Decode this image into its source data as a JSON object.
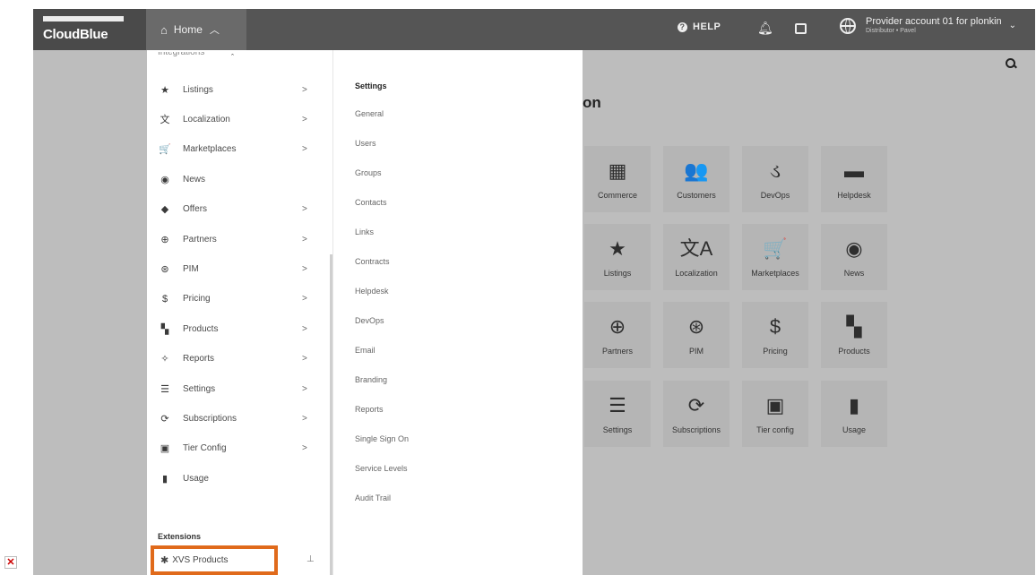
{
  "header": {
    "logo": "CloudBlue",
    "home_label": "Home",
    "help_label": "HELP",
    "account_name": "Provider account 01 for plonkin",
    "account_role": "Distributor • Pavel"
  },
  "page": {
    "heading": "on",
    "tiles": [
      {
        "label": "Commerce",
        "icon": "▦"
      },
      {
        "label": "Customers",
        "icon": "👥"
      },
      {
        "label": "DevOps",
        "icon": "ડ"
      },
      {
        "label": "Helpdesk",
        "icon": "▬"
      },
      {
        "label": "Listings",
        "icon": "★"
      },
      {
        "label": "Localization",
        "icon": "文A"
      },
      {
        "label": "Marketplaces",
        "icon": "🛒"
      },
      {
        "label": "News",
        "icon": "◉"
      },
      {
        "label": "Partners",
        "icon": "⊕"
      },
      {
        "label": "PIM",
        "icon": "⊛"
      },
      {
        "label": "Pricing",
        "icon": "$"
      },
      {
        "label": "Products",
        "icon": "▚"
      },
      {
        "label": "Settings",
        "icon": "☰"
      },
      {
        "label": "Subscriptions",
        "icon": "⟳"
      },
      {
        "label": "Tier config",
        "icon": "▣"
      },
      {
        "label": "Usage",
        "icon": "▮"
      }
    ]
  },
  "menu": {
    "cut_item": "Integrations",
    "items": [
      {
        "label": "Listings",
        "icon": "★",
        "arrow": ">"
      },
      {
        "label": "Localization",
        "icon": "文",
        "arrow": ">"
      },
      {
        "label": "Marketplaces",
        "icon": "🛒",
        "arrow": ">"
      },
      {
        "label": "News",
        "icon": "◉",
        "arrow": ""
      },
      {
        "label": "Offers",
        "icon": "◆",
        "arrow": ">"
      },
      {
        "label": "Partners",
        "icon": "⊕",
        "arrow": ">"
      },
      {
        "label": "PIM",
        "icon": "⊛",
        "arrow": ">"
      },
      {
        "label": "Pricing",
        "icon": "$",
        "arrow": ">"
      },
      {
        "label": "Products",
        "icon": "▚",
        "arrow": ">"
      },
      {
        "label": "Reports",
        "icon": "✧",
        "arrow": ">"
      },
      {
        "label": "Settings",
        "icon": "☰",
        "arrow": ">"
      },
      {
        "label": "Subscriptions",
        "icon": "⟳",
        "arrow": ">"
      },
      {
        "label": "Tier Config",
        "icon": "▣",
        "arrow": ">"
      },
      {
        "label": "Usage",
        "icon": "▮",
        "arrow": ""
      }
    ],
    "extensions_title": "Extensions",
    "extension_item": "XVS Products",
    "extension_icon": "✱"
  },
  "submenu": {
    "title": "Settings",
    "items": [
      "General",
      "Users",
      "Groups",
      "Contacts",
      "Links",
      "Contracts",
      "Helpdesk",
      "DevOps",
      "Email",
      "Branding",
      "Reports",
      "Single Sign On",
      "Service Levels",
      "Audit Trail"
    ]
  },
  "colors": {
    "topbar": "#555555",
    "overlay": "#bdbdbd",
    "highlight": "#e06a1b"
  }
}
